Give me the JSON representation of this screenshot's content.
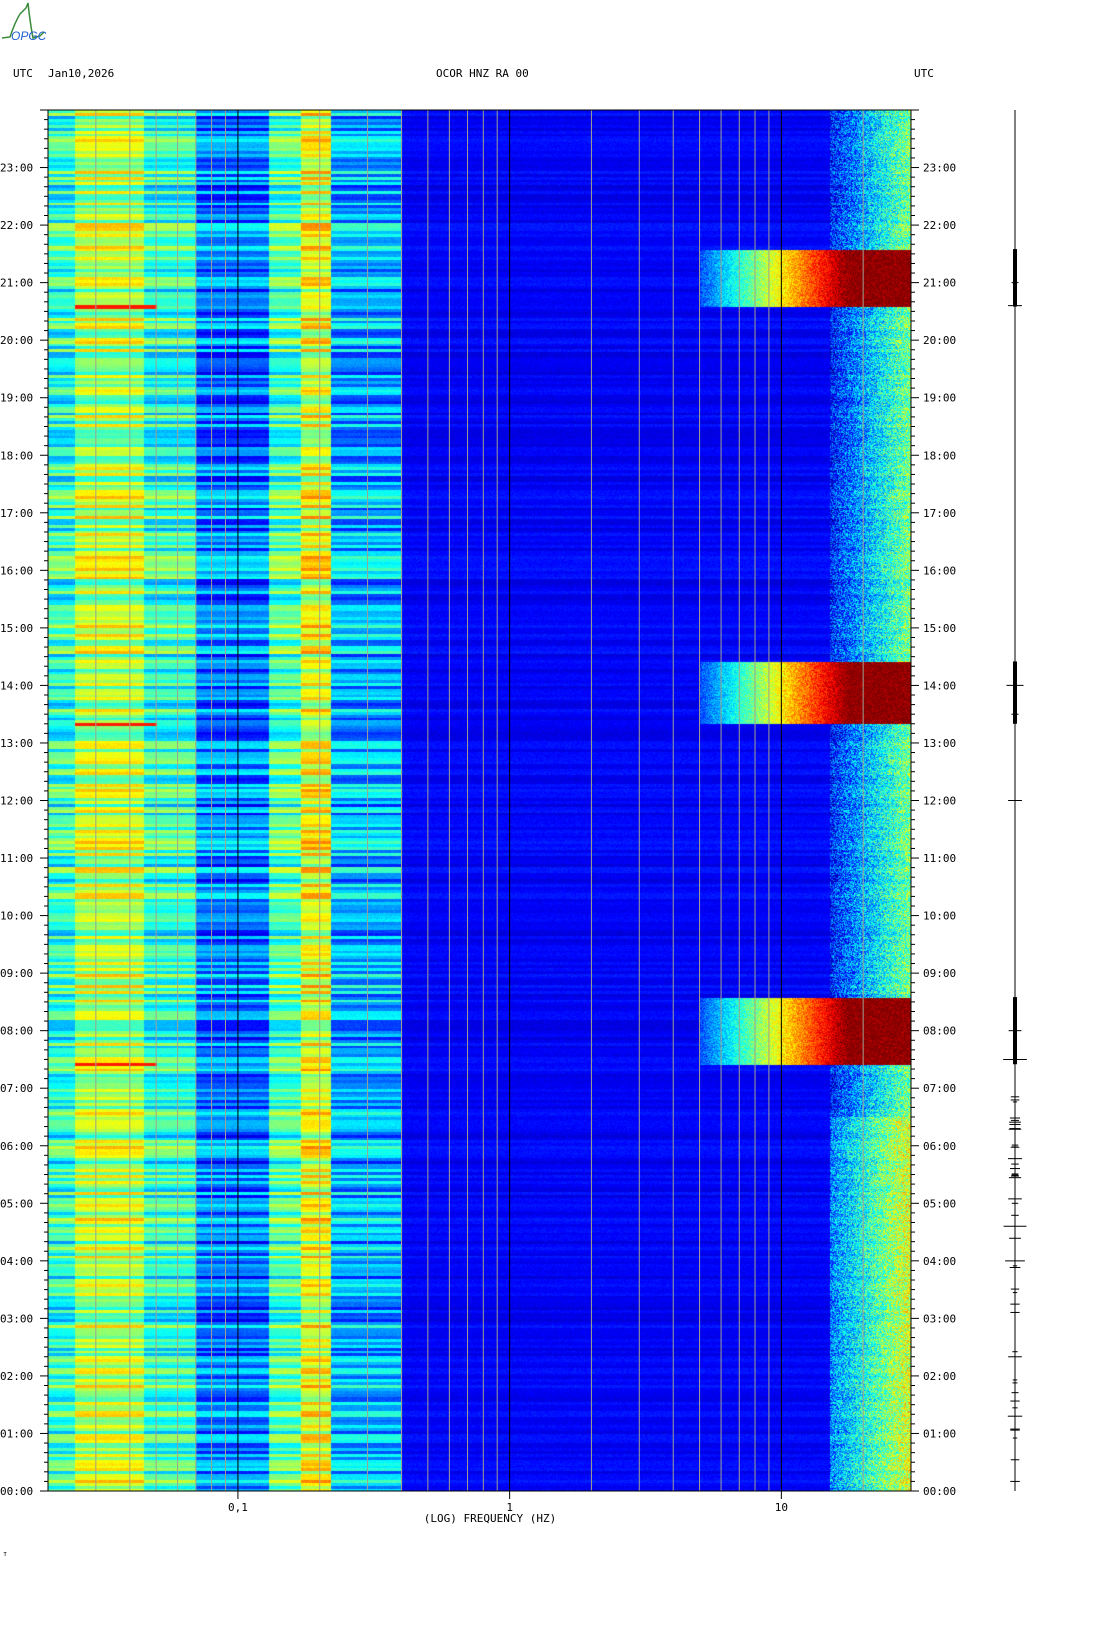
{
  "header": {
    "left_utc": "UTC",
    "date": "Jan10,2026",
    "station": "OCOR HNZ RA 00",
    "right_utc": "UTC"
  },
  "logo_text": "OPGC",
  "footer_mark": "ᴛ",
  "colors": {
    "colormap": "jet",
    "grid_minor": "#a0a090",
    "grid_major": "#000000"
  },
  "chart_data": {
    "type": "heatmap",
    "title": "OCOR HNZ RA 00",
    "xlabel": "(LOG) FREQUENCY (HZ)",
    "ylabel": "UTC",
    "xscale": "log",
    "xlim": [
      0.02,
      30
    ],
    "ylim_hours": [
      0,
      24
    ],
    "xticks": [
      {
        "value": 0.1,
        "label": "0,1"
      },
      {
        "value": 1,
        "label": "1"
      },
      {
        "value": 10,
        "label": "10"
      }
    ],
    "yticks": [
      "00:00",
      "01:00",
      "02:00",
      "03:00",
      "04:00",
      "05:00",
      "06:00",
      "07:00",
      "08:00",
      "09:00",
      "10:00",
      "11:00",
      "12:00",
      "13:00",
      "14:00",
      "15:00",
      "16:00",
      "17:00",
      "18:00",
      "19:00",
      "20:00",
      "21:00",
      "22:00",
      "23:00"
    ],
    "minor_gridlines_hz": [
      0.03,
      0.04,
      0.05,
      0.06,
      0.07,
      0.08,
      0.09,
      0.2,
      0.3,
      0.4,
      0.5,
      0.6,
      0.7,
      0.8,
      0.9,
      2,
      3,
      4,
      5,
      6,
      7,
      8,
      9,
      20
    ],
    "major_gridlines_hz": [
      0.1,
      1,
      10
    ],
    "background_level_by_band": [
      {
        "fmin": 0.02,
        "fmax": 0.025,
        "level": 0.42
      },
      {
        "fmin": 0.025,
        "fmax": 0.045,
        "level": 0.55
      },
      {
        "fmin": 0.045,
        "fmax": 0.07,
        "level": 0.42
      },
      {
        "fmin": 0.07,
        "fmax": 0.13,
        "level": 0.25
      },
      {
        "fmin": 0.13,
        "fmax": 0.17,
        "level": 0.45
      },
      {
        "fmin": 0.17,
        "fmax": 0.22,
        "level": 0.6
      },
      {
        "fmin": 0.22,
        "fmax": 0.4,
        "level": 0.3
      },
      {
        "fmin": 0.4,
        "fmax": 15,
        "level": 0.12
      },
      {
        "fmin": 15,
        "fmax": 30,
        "level": 0.35
      }
    ],
    "events": [
      {
        "start": "07:25",
        "end": "08:35",
        "fmin": 5,
        "peak_level": 1.0
      },
      {
        "start": "13:20",
        "end": "14:25",
        "fmin": 5,
        "peak_level": 1.0
      },
      {
        "start": "20:35",
        "end": "21:35",
        "fmin": 5,
        "peak_level": 1.0
      }
    ],
    "seismogram_bursts_hours": [
      7.5,
      8.0,
      13.5,
      14.0,
      20.6,
      21.0,
      4.0,
      4.6,
      5.0,
      1.3,
      12.0
    ]
  }
}
